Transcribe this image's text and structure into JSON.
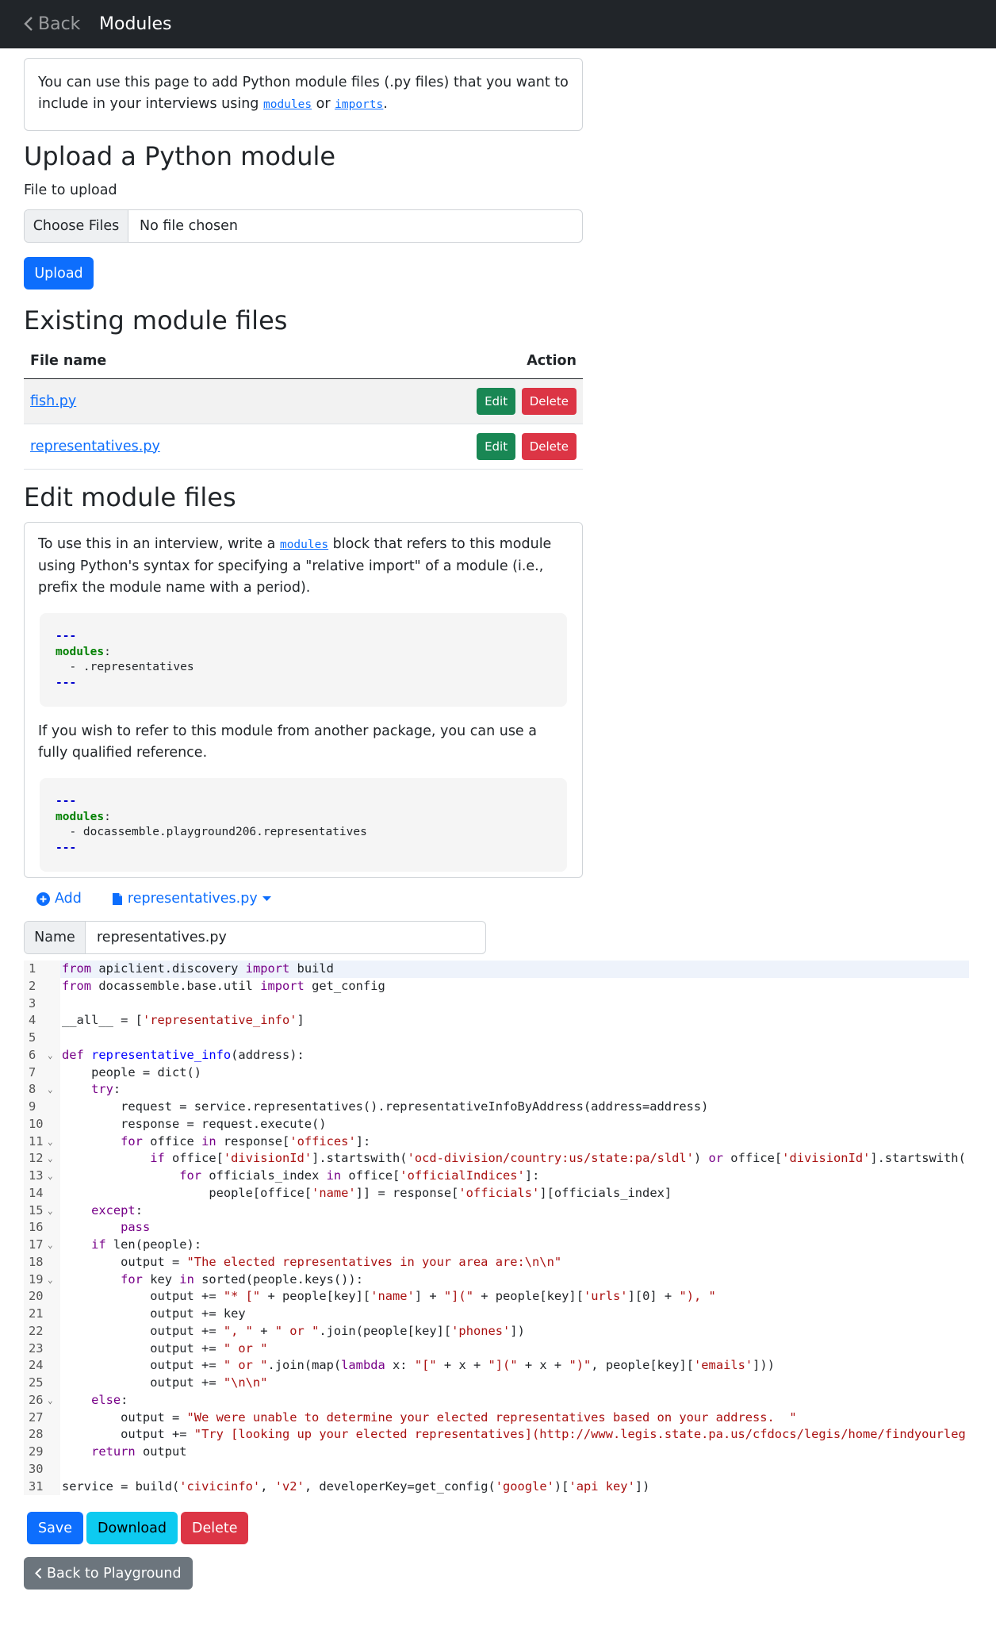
{
  "nav": {
    "back_label": "Back",
    "title": "Modules"
  },
  "intro": {
    "text_before": "You can use this page to add Python module files (.py files) that you want to include in your interviews using ",
    "link1": "modules",
    "text_mid": " or ",
    "link2": "imports",
    "text_end": "."
  },
  "upload": {
    "heading": "Upload a Python module",
    "label": "File to upload",
    "choose_button": "Choose Files",
    "no_file": "No file chosen",
    "upload_button": "Upload"
  },
  "existing": {
    "heading": "Existing module files",
    "columns": [
      "File name",
      "Action"
    ],
    "rows": [
      {
        "file": "fish.py",
        "edit": "Edit",
        "delete": "Delete"
      },
      {
        "file": "representatives.py",
        "edit": "Edit",
        "delete": "Delete"
      }
    ]
  },
  "edit": {
    "heading": "Edit module files",
    "p1_before": "To use this in an interview, write a ",
    "p1_link": "modules",
    "p1_after": " block that refers to this module using Python's syntax for specifying a \"relative import\" of a module (i.e., prefix the module name with a period).",
    "yaml1": {
      "sep": "---",
      "key": "modules",
      "colon": ":",
      "item": "  - .representatives"
    },
    "p2": "If you wish to refer to this module from another package, you can use a fully qualified reference.",
    "yaml2": {
      "sep": "---",
      "key": "modules",
      "colon": ":",
      "item": "  - docassemble.playground206.representatives"
    }
  },
  "tabs": {
    "add": "Add",
    "file": "representatives.py"
  },
  "name_field": {
    "label": "Name",
    "value": "representatives.py"
  },
  "code_lines": [
    "from apiclient.discovery import build",
    "from docassemble.base.util import get_config",
    "",
    "__all__ = ['representative_info']",
    "",
    "def representative_info(address):",
    "    people = dict()",
    "    try:",
    "        request = service.representatives().representativeInfoByAddress(address=address)",
    "        response = request.execute()",
    "        for office in response['offices']:",
    "            if office['divisionId'].startswith('ocd-division/country:us/state:pa/sldl') or office['divisionId'].startswith(",
    "                for officials_index in office['officialIndices']:",
    "                    people[office['name']] = response['officials'][officials_index]",
    "    except:",
    "        pass",
    "    if len(people):",
    "        output = \"The elected representatives in your area are:\\n\\n\"",
    "        for key in sorted(people.keys()):",
    "            output += \"* [\" + people[key]['name'] + \"](\" + people[key]['urls'][0] + \"), \"",
    "            output += key",
    "            output += \", \" + \" or \".join(people[key]['phones'])",
    "            output += \" or \"",
    "            output += \" or \".join(map(lambda x: \"[\" + x + \"](\" + x + \")\", people[key]['emails']))",
    "            output += \"\\n\\n\"",
    "    else:",
    "        output = \"We were unable to determine your elected representatives based on your address.  \"",
    "        output += \"Try [looking up your elected representatives](http://www.legis.state.pa.us/cfdocs/legis/home/findyourleg",
    "    return output",
    "",
    "service = build('civicinfo', 'v2', developerKey=get_config('google')['api key'])"
  ],
  "fold_lines": [
    6,
    8,
    11,
    12,
    13,
    15,
    17,
    19,
    26
  ],
  "buttons": {
    "save": "Save",
    "download": "Download",
    "delete": "Delete",
    "back_playground": "Back to Playground"
  }
}
